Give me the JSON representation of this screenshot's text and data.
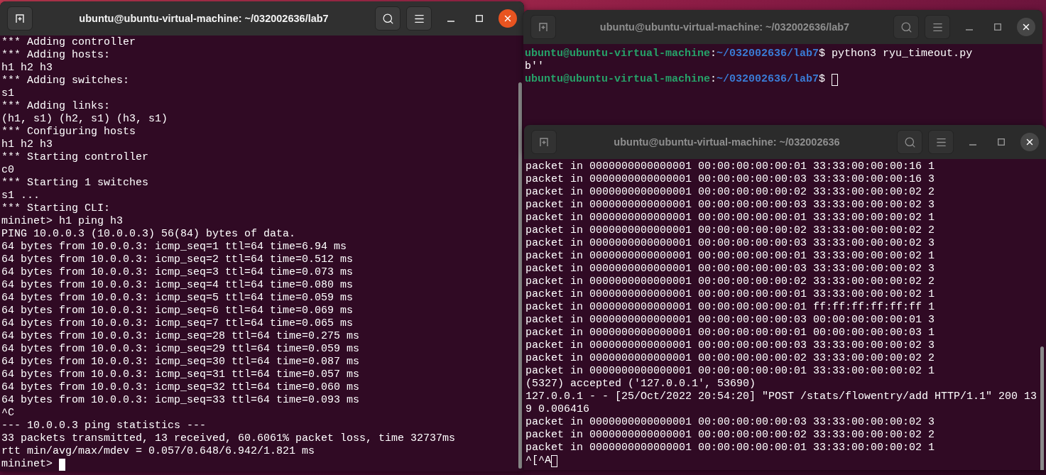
{
  "windows": [
    {
      "title": "ubuntu@ubuntu-virtual-machine: ~/032002636/lab7",
      "focused": true,
      "lines": [
        {
          "kind": "text",
          "text": "*** Adding controller"
        },
        {
          "kind": "text",
          "text": "*** Adding hosts:"
        },
        {
          "kind": "text",
          "text": "h1 h2 h3"
        },
        {
          "kind": "text",
          "text": "*** Adding switches:"
        },
        {
          "kind": "text",
          "text": "s1"
        },
        {
          "kind": "text",
          "text": "*** Adding links:"
        },
        {
          "kind": "text",
          "text": "(h1, s1) (h2, s1) (h3, s1)"
        },
        {
          "kind": "text",
          "text": "*** Configuring hosts"
        },
        {
          "kind": "text",
          "text": "h1 h2 h3"
        },
        {
          "kind": "text",
          "text": "*** Starting controller"
        },
        {
          "kind": "text",
          "text": "c0"
        },
        {
          "kind": "text",
          "text": "*** Starting 1 switches"
        },
        {
          "kind": "text",
          "text": "s1 ..."
        },
        {
          "kind": "text",
          "text": "*** Starting CLI:"
        },
        {
          "kind": "text",
          "text": "mininet> h1 ping h3"
        },
        {
          "kind": "text",
          "text": "PING 10.0.0.3 (10.0.0.3) 56(84) bytes of data."
        },
        {
          "kind": "text",
          "text": "64 bytes from 10.0.0.3: icmp_seq=1 ttl=64 time=6.94 ms"
        },
        {
          "kind": "text",
          "text": "64 bytes from 10.0.0.3: icmp_seq=2 ttl=64 time=0.512 ms"
        },
        {
          "kind": "text",
          "text": "64 bytes from 10.0.0.3: icmp_seq=3 ttl=64 time=0.073 ms"
        },
        {
          "kind": "text",
          "text": "64 bytes from 10.0.0.3: icmp_seq=4 ttl=64 time=0.080 ms"
        },
        {
          "kind": "text",
          "text": "64 bytes from 10.0.0.3: icmp_seq=5 ttl=64 time=0.059 ms"
        },
        {
          "kind": "text",
          "text": "64 bytes from 10.0.0.3: icmp_seq=6 ttl=64 time=0.069 ms"
        },
        {
          "kind": "text",
          "text": "64 bytes from 10.0.0.3: icmp_seq=7 ttl=64 time=0.065 ms"
        },
        {
          "kind": "text",
          "text": "64 bytes from 10.0.0.3: icmp_seq=28 ttl=64 time=0.275 ms"
        },
        {
          "kind": "text",
          "text": "64 bytes from 10.0.0.3: icmp_seq=29 ttl=64 time=0.059 ms"
        },
        {
          "kind": "text",
          "text": "64 bytes from 10.0.0.3: icmp_seq=30 ttl=64 time=0.087 ms"
        },
        {
          "kind": "text",
          "text": "64 bytes from 10.0.0.3: icmp_seq=31 ttl=64 time=0.057 ms"
        },
        {
          "kind": "text",
          "text": "64 bytes from 10.0.0.3: icmp_seq=32 ttl=64 time=0.060 ms"
        },
        {
          "kind": "text",
          "text": "64 bytes from 10.0.0.3: icmp_seq=33 ttl=64 time=0.093 ms"
        },
        {
          "kind": "text",
          "text": "^C"
        },
        {
          "kind": "text",
          "text": "--- 10.0.0.3 ping statistics ---"
        },
        {
          "kind": "text",
          "text": "33 packets transmitted, 13 received, 60.6061% packet loss, time 32737ms"
        },
        {
          "kind": "text",
          "text": "rtt min/avg/max/mdev = 0.057/0.648/6.942/1.821 ms"
        },
        {
          "kind": "text",
          "text": "mininet> ",
          "cursor": true
        }
      ]
    },
    {
      "title": "ubuntu@ubuntu-virtual-machine: ~/032002636/lab7",
      "focused": false,
      "lines": [
        {
          "kind": "prompt",
          "user": "ubuntu@ubuntu-virtual-machine",
          "separator": ":",
          "path": "~/032002636/lab7",
          "text": "$ python3 ryu_timeout.py"
        },
        {
          "kind": "text",
          "text": "b''"
        },
        {
          "kind": "prompt",
          "user": "ubuntu@ubuntu-virtual-machine",
          "separator": ":",
          "path": "~/032002636/lab7",
          "text": "$ ",
          "cursor": true
        }
      ]
    },
    {
      "title": "ubuntu@ubuntu-virtual-machine: ~/032002636",
      "focused": false,
      "lines": [
        {
          "kind": "text",
          "text": "packet in 0000000000000001 00:00:00:00:00:01 33:33:00:00:00:16 1"
        },
        {
          "kind": "text",
          "text": "packet in 0000000000000001 00:00:00:00:00:03 33:33:00:00:00:16 3"
        },
        {
          "kind": "text",
          "text": "packet in 0000000000000001 00:00:00:00:00:02 33:33:00:00:00:02 2"
        },
        {
          "kind": "text",
          "text": "packet in 0000000000000001 00:00:00:00:00:03 33:33:00:00:00:02 3"
        },
        {
          "kind": "text",
          "text": "packet in 0000000000000001 00:00:00:00:00:01 33:33:00:00:00:02 1"
        },
        {
          "kind": "text",
          "text": "packet in 0000000000000001 00:00:00:00:00:02 33:33:00:00:00:02 2"
        },
        {
          "kind": "text",
          "text": "packet in 0000000000000001 00:00:00:00:00:03 33:33:00:00:00:02 3"
        },
        {
          "kind": "text",
          "text": "packet in 0000000000000001 00:00:00:00:00:01 33:33:00:00:00:02 1"
        },
        {
          "kind": "text",
          "text": "packet in 0000000000000001 00:00:00:00:00:03 33:33:00:00:00:02 3"
        },
        {
          "kind": "text",
          "text": "packet in 0000000000000001 00:00:00:00:00:02 33:33:00:00:00:02 2"
        },
        {
          "kind": "text",
          "text": "packet in 0000000000000001 00:00:00:00:00:01 33:33:00:00:00:02 1"
        },
        {
          "kind": "text",
          "text": "packet in 0000000000000001 00:00:00:00:00:01 ff:ff:ff:ff:ff:ff 1"
        },
        {
          "kind": "text",
          "text": "packet in 0000000000000001 00:00:00:00:00:03 00:00:00:00:00:01 3"
        },
        {
          "kind": "text",
          "text": "packet in 0000000000000001 00:00:00:00:00:01 00:00:00:00:00:03 1"
        },
        {
          "kind": "text",
          "text": "packet in 0000000000000001 00:00:00:00:00:03 33:33:00:00:00:02 3"
        },
        {
          "kind": "text",
          "text": "packet in 0000000000000001 00:00:00:00:00:02 33:33:00:00:00:02 2"
        },
        {
          "kind": "text",
          "text": "packet in 0000000000000001 00:00:00:00:00:01 33:33:00:00:00:02 1"
        },
        {
          "kind": "text",
          "text": "(5327) accepted ('127.0.0.1', 53690)"
        },
        {
          "kind": "text",
          "text": "127.0.0.1 - - [25/Oct/2022 20:54:20] \"POST /stats/flowentry/add HTTP/1.1\" 200 13"
        },
        {
          "kind": "text",
          "text": "9 0.006416"
        },
        {
          "kind": "text",
          "text": "packet in 0000000000000001 00:00:00:00:00:03 33:33:00:00:00:02 3"
        },
        {
          "kind": "text",
          "text": "packet in 0000000000000001 00:00:00:00:00:02 33:33:00:00:00:02 2"
        },
        {
          "kind": "text",
          "text": "packet in 0000000000000001 00:00:00:00:00:01 33:33:00:00:00:02 1"
        },
        {
          "kind": "text",
          "text": "^[^A",
          "cursor": true
        }
      ]
    }
  ]
}
